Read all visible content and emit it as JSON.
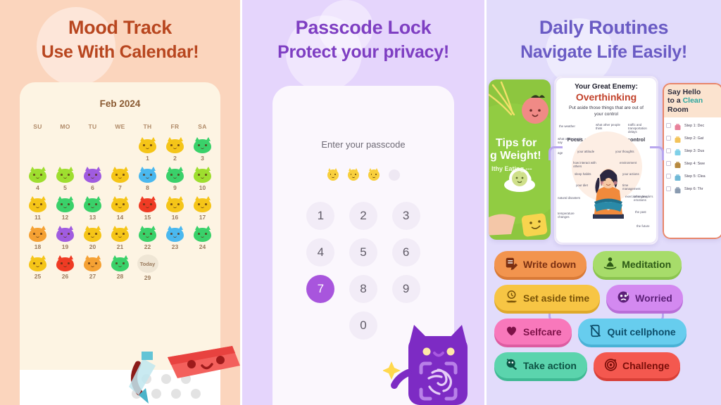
{
  "panels": [
    {
      "id": "mood-track",
      "bg": "#fbd5bd",
      "heading": {
        "line1": "Mood Track",
        "line2": "Use With Calendar!",
        "color": "#b8461f"
      },
      "calendar": {
        "title": "Feb 2024",
        "weekdays": [
          "SU",
          "MO",
          "TU",
          "WE",
          "TH",
          "FR",
          "SA"
        ],
        "today_label": "Today",
        "weeks": [
          [
            {
              "type": "empty"
            },
            {
              "type": "empty"
            },
            {
              "type": "empty"
            },
            {
              "type": "empty"
            },
            {
              "type": "mood",
              "day": "1",
              "color": "#f5c518",
              "mood": "happy"
            },
            {
              "type": "mood",
              "day": "2",
              "color": "#f5c518",
              "mood": "happy"
            },
            {
              "type": "mood",
              "day": "3",
              "color": "#3ad16a",
              "mood": "calm"
            }
          ],
          [
            {
              "type": "mood",
              "day": "4",
              "color": "#9ede2f",
              "mood": "content"
            },
            {
              "type": "mood",
              "day": "5",
              "color": "#9ede2f",
              "mood": "content"
            },
            {
              "type": "mood",
              "day": "6",
              "color": "#a05ce0",
              "mood": "tired"
            },
            {
              "type": "mood",
              "day": "7",
              "color": "#f5c518",
              "mood": "happy"
            },
            {
              "type": "mood",
              "day": "8",
              "color": "#4ab8ef",
              "mood": "sad"
            },
            {
              "type": "mood",
              "day": "9",
              "color": "#3ad16a",
              "mood": "calm"
            },
            {
              "type": "mood",
              "day": "10",
              "color": "#9ede2f",
              "mood": "content"
            }
          ],
          [
            {
              "type": "mood",
              "day": "11",
              "color": "#f5c518",
              "mood": "happy"
            },
            {
              "type": "mood",
              "day": "12",
              "color": "#3ad16a",
              "mood": "calm"
            },
            {
              "type": "mood",
              "day": "13",
              "color": "#3ad16a",
              "mood": "calm"
            },
            {
              "type": "mood",
              "day": "14",
              "color": "#f5c518",
              "mood": "happy"
            },
            {
              "type": "mood",
              "day": "15",
              "color": "#ef3b24",
              "mood": "angry"
            },
            {
              "type": "mood",
              "day": "16",
              "color": "#f5c518",
              "mood": "happy"
            },
            {
              "type": "mood",
              "day": "17",
              "color": "#f5c518",
              "mood": "happy"
            }
          ],
          [
            {
              "type": "mood",
              "day": "18",
              "color": "#f5a133",
              "mood": "excited"
            },
            {
              "type": "mood",
              "day": "19",
              "color": "#a05ce0",
              "mood": "tired"
            },
            {
              "type": "mood",
              "day": "20",
              "color": "#f5c518",
              "mood": "happy"
            },
            {
              "type": "mood",
              "day": "21",
              "color": "#f5c518",
              "mood": "happy"
            },
            {
              "type": "mood",
              "day": "22",
              "color": "#3ad16a",
              "mood": "calm"
            },
            {
              "type": "mood",
              "day": "23",
              "color": "#4ab8ef",
              "mood": "sad"
            },
            {
              "type": "mood",
              "day": "24",
              "color": "#3ad16a",
              "mood": "calm"
            }
          ],
          [
            {
              "type": "mood",
              "day": "25",
              "color": "#f5c518",
              "mood": "happy"
            },
            {
              "type": "mood",
              "day": "26",
              "color": "#ef3b24",
              "mood": "angry"
            },
            {
              "type": "mood",
              "day": "27",
              "color": "#f5a133",
              "mood": "excited"
            },
            {
              "type": "mood",
              "day": "28",
              "color": "#3ad16a",
              "mood": "calm"
            },
            {
              "type": "today",
              "day": "29"
            },
            {
              "type": "empty"
            },
            {
              "type": "empty"
            }
          ]
        ]
      }
    },
    {
      "id": "passcode-lock",
      "bg": "#e5d5fc",
      "heading": {
        "line1": "Passcode Lock",
        "line2": "Protect your privacy!",
        "color": "#7e3ec2"
      },
      "passcode": {
        "prompt": "Enter your passcode",
        "dots_total": 4,
        "dots_filled": 3,
        "keys": [
          "1",
          "2",
          "3",
          "4",
          "5",
          "6",
          "7",
          "8",
          "9",
          "",
          "0",
          ""
        ],
        "active_key": "7",
        "active_key_color": "#a855dd",
        "mascot": "fingerprint-cat"
      }
    },
    {
      "id": "daily-routines",
      "bg": "#e2dcfb",
      "heading": {
        "line1": "Daily Routines",
        "line2": "Navigate Life Easily!",
        "color": "#6a5bc4"
      },
      "cards": {
        "green": {
          "line1": "Tips for",
          "line2": "g Weight!",
          "line3": "lthy Eating ---"
        },
        "center": {
          "eyebrow": "Your Great Enemy:",
          "title": "Overthinking",
          "subtitle": "Put aside those things that are out of your control",
          "inner_title": "Focus on what you can control",
          "outer_words": [
            "the weather",
            "what other people think",
            "traffic and transportation delays",
            "what other people say",
            "age",
            "natural disasters",
            "temperature changes",
            "other people's emotions",
            "the past",
            "the future"
          ],
          "inner_words": [
            "your attitude",
            "your thoughts",
            "how interact with others",
            "environment",
            "sleep habits",
            "your actions",
            "your diet",
            "time management",
            "exercise routine"
          ]
        },
        "right": {
          "title_l1": "Say Hello",
          "title_l2_a": "to a ",
          "title_l2_b": "Clean",
          "title_l3": "Room",
          "steps": [
            "Step 1: Dec",
            "Step 2: Gat",
            "Step 3: Dus",
            "Step 4: Swe",
            "Step 5: Clea",
            "Step 6: Thr"
          ]
        }
      },
      "pills": [
        {
          "label": "Write down",
          "bg": "#f2944e",
          "shadow": "#d97a36",
          "text": "#7a2f12",
          "icon": "note-pencil-icon"
        },
        {
          "label": "Meditation",
          "bg": "#a7dc6a",
          "shadow": "#8bc44f",
          "text": "#2d5a16",
          "icon": "meditation-icon"
        },
        {
          "label": "Set aside time",
          "bg": "#f7c544",
          "shadow": "#dfa92a",
          "text": "#7a5408",
          "icon": "clock-person-icon"
        },
        {
          "label": "Worried",
          "bg": "#d389f0",
          "shadow": "#b96ed8",
          "text": "#5c1f78",
          "icon": "worried-face-icon"
        },
        {
          "label": "Selfcare",
          "bg": "#f878bb",
          "shadow": "#dd5ca1",
          "text": "#7d1148",
          "icon": "heart-icon"
        },
        {
          "label": "Quit cellphone",
          "bg": "#67cdee",
          "shadow": "#49b2d6",
          "text": "#0d4e6a",
          "icon": "phone-off-icon"
        },
        {
          "label": "Take action",
          "bg": "#5bd4ad",
          "shadow": "#3fb993",
          "text": "#0c5243",
          "icon": "rocket-icon"
        },
        {
          "label": "Challenge",
          "bg": "#f4584f",
          "shadow": "#d83f37",
          "text": "#7a0e09",
          "icon": "target-icon"
        }
      ]
    }
  ]
}
